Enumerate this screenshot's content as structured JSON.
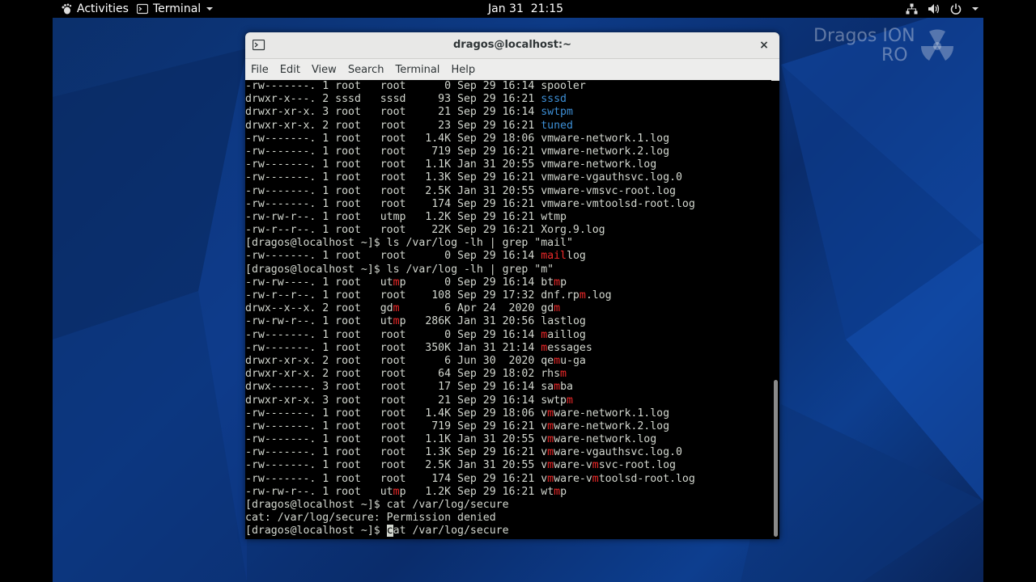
{
  "topbar": {
    "activities": "Activities",
    "app_menu": "Terminal",
    "clock": "Jan 31  21:15"
  },
  "watermark": {
    "line1": "Dragos ION",
    "line2": "RO"
  },
  "window": {
    "title": "dragos@localhost:~",
    "close": "×"
  },
  "menu": {
    "file": "File",
    "edit": "Edit",
    "view": "View",
    "search": "Search",
    "terminal": "Terminal",
    "help": "Help"
  },
  "colors": {
    "directory": "#3d8fd6",
    "match": "#ef2929",
    "text": "#d3d7cf"
  },
  "lines": [
    [
      [
        "-rw-------. 1 root   root      0 Sep 29 16:14 spooler",
        ""
      ]
    ],
    [
      [
        "drwxr-x---. 2 sssd   sssd     93 Sep 29 16:21 ",
        ""
      ],
      [
        "sssd",
        "blue"
      ]
    ],
    [
      [
        "drwxr-xr-x. 3 root   root     21 Sep 29 16:14 ",
        ""
      ],
      [
        "swtpm",
        "blue"
      ]
    ],
    [
      [
        "drwxr-xr-x. 2 root   root     23 Sep 29 16:21 ",
        ""
      ],
      [
        "tuned",
        "blue"
      ]
    ],
    [
      [
        "-rw-------. 1 root   root   1.4K Sep 29 18:06 vmware-network.1.log",
        ""
      ]
    ],
    [
      [
        "-rw-------. 1 root   root    719 Sep 29 16:21 vmware-network.2.log",
        ""
      ]
    ],
    [
      [
        "-rw-------. 1 root   root   1.1K Jan 31 20:55 vmware-network.log",
        ""
      ]
    ],
    [
      [
        "-rw-------. 1 root   root   1.3K Sep 29 16:21 vmware-vgauthsvc.log.0",
        ""
      ]
    ],
    [
      [
        "-rw-------. 1 root   root   2.5K Jan 31 20:55 vmware-vmsvc-root.log",
        ""
      ]
    ],
    [
      [
        "-rw-------. 1 root   root    174 Sep 29 16:21 vmware-vmtoolsd-root.log",
        ""
      ]
    ],
    [
      [
        "-rw-rw-r--. 1 root   utmp   1.2K Sep 29 16:21 wtmp",
        ""
      ]
    ],
    [
      [
        "-rw-r--r--. 1 root   root    22K Sep 29 16:21 Xorg.9.log",
        ""
      ]
    ],
    [
      [
        "[dragos@localhost ~]$ ls /var/log -lh | grep \"mail\"",
        ""
      ]
    ],
    [
      [
        "-rw-------. 1 root   root      0 Sep 29 16:14 ",
        ""
      ],
      [
        "mail",
        "red"
      ],
      [
        "log",
        ""
      ]
    ],
    [
      [
        "[dragos@localhost ~]$ ls /var/log -lh | grep \"m\"",
        ""
      ]
    ],
    [
      [
        "-rw-rw----. 1 root   ut",
        ""
      ],
      [
        "m",
        "red"
      ],
      [
        "p      0 Sep 29 16:14 bt",
        ""
      ],
      [
        "m",
        "red"
      ],
      [
        "p",
        ""
      ]
    ],
    [
      [
        "-rw-r--r--. 1 root   root    108 Sep 29 17:32 dnf.rp",
        ""
      ],
      [
        "m",
        "red"
      ],
      [
        ".log",
        ""
      ]
    ],
    [
      [
        "drwx--x--x. 2 root   gd",
        ""
      ],
      [
        "m",
        "red"
      ],
      [
        "       6 Apr 24  2020 gd",
        ""
      ],
      [
        "m",
        "red"
      ]
    ],
    [
      [
        "-rw-rw-r--. 1 root   ut",
        ""
      ],
      [
        "m",
        "red"
      ],
      [
        "p   286K Jan 31 20:56 lastlog",
        ""
      ]
    ],
    [
      [
        "-rw-------. 1 root   root      0 Sep 29 16:14 ",
        ""
      ],
      [
        "m",
        "red"
      ],
      [
        "aillog",
        ""
      ]
    ],
    [
      [
        "-rw-------. 1 root   root   350K Jan 31 21:14 ",
        ""
      ],
      [
        "m",
        "red"
      ],
      [
        "essages",
        ""
      ]
    ],
    [
      [
        "drwxr-xr-x. 2 root   root      6 Jun 30  2020 qe",
        ""
      ],
      [
        "m",
        "red"
      ],
      [
        "u-ga",
        ""
      ]
    ],
    [
      [
        "drwxr-xr-x. 2 root   root     64 Sep 29 18:02 rhs",
        ""
      ],
      [
        "m",
        "red"
      ]
    ],
    [
      [
        "drwx------. 3 root   root     17 Sep 29 16:14 sa",
        ""
      ],
      [
        "m",
        "red"
      ],
      [
        "ba",
        ""
      ]
    ],
    [
      [
        "drwxr-xr-x. 3 root   root     21 Sep 29 16:14 swtp",
        ""
      ],
      [
        "m",
        "red"
      ]
    ],
    [
      [
        "-rw-------. 1 root   root   1.4K Sep 29 18:06 v",
        ""
      ],
      [
        "m",
        "red"
      ],
      [
        "ware-network.1.log",
        ""
      ]
    ],
    [
      [
        "-rw-------. 1 root   root    719 Sep 29 16:21 v",
        ""
      ],
      [
        "m",
        "red"
      ],
      [
        "ware-network.2.log",
        ""
      ]
    ],
    [
      [
        "-rw-------. 1 root   root   1.1K Jan 31 20:55 v",
        ""
      ],
      [
        "m",
        "red"
      ],
      [
        "ware-network.log",
        ""
      ]
    ],
    [
      [
        "-rw-------. 1 root   root   1.3K Sep 29 16:21 v",
        ""
      ],
      [
        "m",
        "red"
      ],
      [
        "ware-vgauthsvc.log.0",
        ""
      ]
    ],
    [
      [
        "-rw-------. 1 root   root   2.5K Jan 31 20:55 v",
        ""
      ],
      [
        "m",
        "red"
      ],
      [
        "ware-v",
        ""
      ],
      [
        "m",
        "red"
      ],
      [
        "svc-root.log",
        ""
      ]
    ],
    [
      [
        "-rw-------. 1 root   root    174 Sep 29 16:21 v",
        ""
      ],
      [
        "m",
        "red"
      ],
      [
        "ware-v",
        ""
      ],
      [
        "m",
        "red"
      ],
      [
        "toolsd-root.log",
        ""
      ]
    ],
    [
      [
        "-rw-rw-r--. 1 root   ut",
        ""
      ],
      [
        "m",
        "red"
      ],
      [
        "p   1.2K Sep 29 16:21 wt",
        ""
      ],
      [
        "m",
        "red"
      ],
      [
        "p",
        ""
      ]
    ],
    [
      [
        "[dragos@localhost ~]$ cat /var/log/secure",
        ""
      ]
    ],
    [
      [
        "cat: /var/log/secure: Permission denied",
        ""
      ]
    ],
    [
      [
        "[dragos@localhost ~]$ ",
        ""
      ],
      [
        "c",
        "cursor"
      ],
      [
        "at /var/log/secure",
        ""
      ]
    ]
  ]
}
